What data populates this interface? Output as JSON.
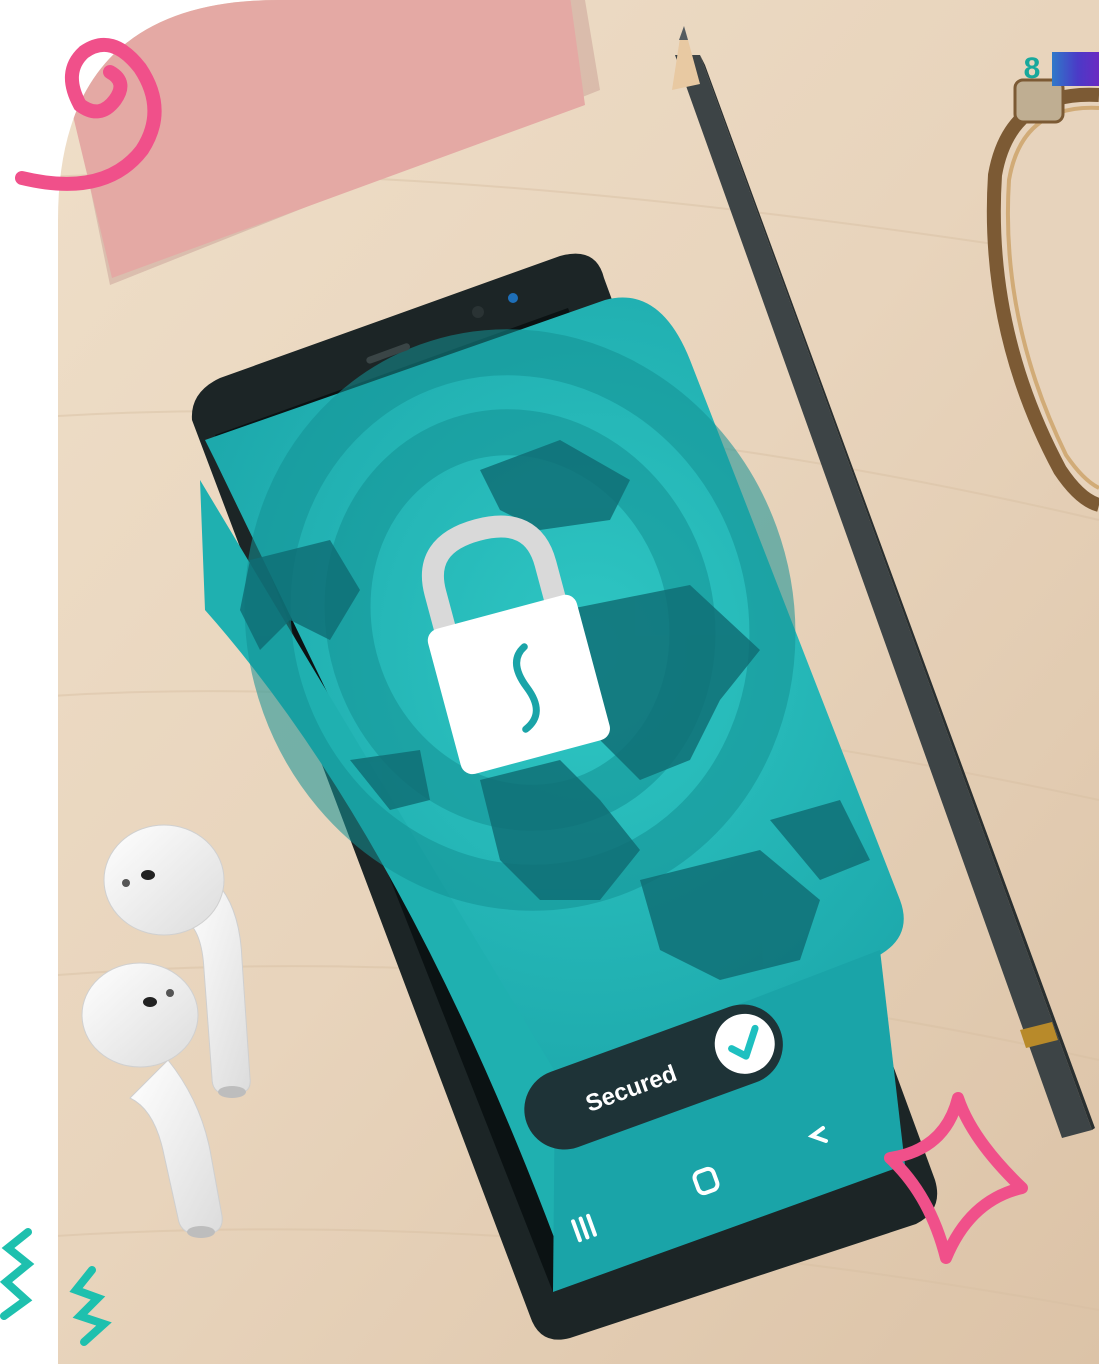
{
  "page": {
    "number": "8"
  },
  "screen": {
    "status_label": "Secured",
    "lock_glyph": "S",
    "nav": {
      "recents": "III",
      "home": "O",
      "back": "<"
    }
  },
  "colors": {
    "desk": "#e9d6bf",
    "sticky_note": "#e4a9a4",
    "screen_teal": "#23b3b3",
    "screen_dark": "#0f6d74",
    "accent_pink": "#f0508a",
    "accent_teal": "#1ec0ae",
    "pencil": "#3d4446",
    "page_tab_start": "#2f79c9",
    "page_tab_end": "#6a2ac2"
  },
  "icons": [
    "lock-icon",
    "check-icon",
    "recents-icon",
    "home-icon",
    "back-icon",
    "swirl-icon",
    "sparkle-icon",
    "squiggle-icon"
  ]
}
